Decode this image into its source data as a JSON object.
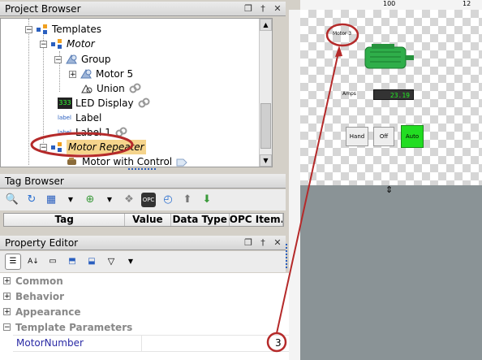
{
  "project_browser": {
    "title": "Project Browser",
    "items": [
      {
        "label": "Templates",
        "italic": false
      },
      {
        "label": "Motor",
        "italic": true
      },
      {
        "label": "Group",
        "italic": false
      },
      {
        "label": "Motor 5",
        "italic": false
      },
      {
        "label": "Union",
        "italic": false
      },
      {
        "label": "LED Display",
        "italic": false
      },
      {
        "label": "Label",
        "italic": false
      },
      {
        "label": "Label 1",
        "italic": false
      },
      {
        "label": "Motor Repeater",
        "italic": true
      },
      {
        "label": "Motor with Control",
        "italic": false
      }
    ],
    "icon_texts": {
      "led": "333",
      "label": "label"
    }
  },
  "tag_browser": {
    "title": "Tag Browser",
    "columns": [
      "Tag",
      "Value",
      "Data Type",
      "OPC Item..."
    ],
    "opc_text": "OPC"
  },
  "property_editor": {
    "title": "Property Editor",
    "categories": [
      "Common",
      "Behavior",
      "Appearance",
      "Template Parameters"
    ],
    "param_name": "MotorNumber",
    "param_value": "3"
  },
  "canvas": {
    "ruler_labels": [
      "100",
      "12"
    ],
    "motor_label": "Motor 3",
    "amps_label": "Amps",
    "amps_value": "23.19",
    "buttons": [
      "Hand",
      "Off",
      "Auto"
    ]
  },
  "colors": {
    "highlight_circle": "#b52a2a",
    "selected_item_bg": "#f5d48c",
    "auto_button": "#22dd22",
    "led_text": "#22ee22",
    "motor_green": "#2fae4a"
  }
}
